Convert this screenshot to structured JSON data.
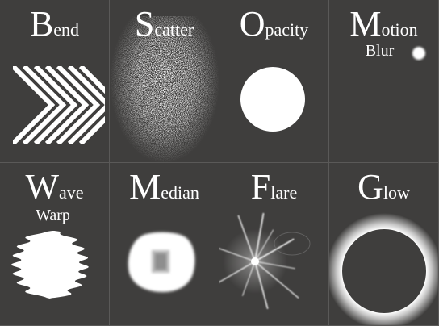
{
  "tiles": [
    {
      "initial": "B",
      "rest": "end",
      "sub": ""
    },
    {
      "initial": "S",
      "rest": "catter",
      "sub": ""
    },
    {
      "initial": "O",
      "rest": "pacity",
      "sub": ""
    },
    {
      "initial": "M",
      "rest": "otion",
      "sub": "Blur"
    },
    {
      "initial": "W",
      "rest": "ave",
      "sub": "Warp"
    },
    {
      "initial": "M",
      "rest": "edian",
      "sub": ""
    },
    {
      "initial": "F",
      "rest": "lare",
      "sub": ""
    },
    {
      "initial": "G",
      "rest": "low",
      "sub": ""
    }
  ],
  "colors": {
    "background": "#3f3e3d",
    "foreground": "#ffffff",
    "divider": "#5a5958"
  }
}
